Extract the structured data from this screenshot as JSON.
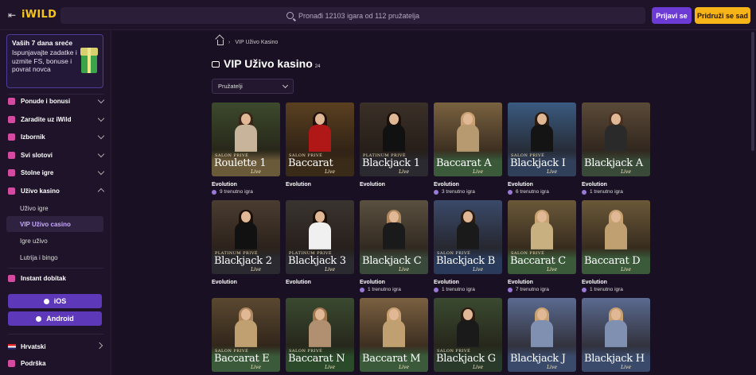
{
  "header": {
    "logo": "iWILD",
    "search_placeholder": "Pronađi 12103 igara od 112 pružatelja",
    "login_label": "Prijavi se",
    "join_label": "Pridruži se sad"
  },
  "sidebar": {
    "promo": {
      "title": "Vaših 7 dana sreće",
      "text": "Ispunjavajte zadatke i uzmite FS, bonuse i povrat novca"
    },
    "items": [
      {
        "label": "Ponude i bonusi",
        "icon": "gift-icon"
      },
      {
        "label": "Zaradite uz iWild",
        "icon": "coins-icon"
      },
      {
        "label": "Izbornik",
        "icon": "menu-icon"
      },
      {
        "label": "Svi slotovi",
        "icon": "slot-icon"
      },
      {
        "label": "Stolne igre",
        "icon": "table-icon"
      },
      {
        "label": "Uživo kasino",
        "icon": "live-icon"
      }
    ],
    "subitems": [
      {
        "label": "Uživo igre"
      },
      {
        "label": "VIP Uživo casino"
      },
      {
        "label": "Igre uživo"
      },
      {
        "label": "Lutrija i bingo"
      }
    ],
    "instant": "Instant dobitak",
    "ios_label": "iOS",
    "android_label": "Android",
    "language": "Hrvatski",
    "support": "Podrška"
  },
  "breadcrumb": {
    "current": "VIP Uživo Kasino"
  },
  "page": {
    "title": "VIP Uživo kasino",
    "count": "24",
    "filter_label": "Pružatelji"
  },
  "games": [
    {
      "sub": "SALON PRIVÉ",
      "name": "Roulette 1",
      "provider": "Evolution",
      "players": "9 trenutno igra",
      "bg": "#3c4a2c",
      "band": "#6b5a3a",
      "hair": "#3a2418",
      "dress": "#c8b49a"
    },
    {
      "sub": "SALON PRIVÉ",
      "name": "Baccarat",
      "provider": "Evolution",
      "players": "",
      "bg": "#5a4020",
      "band": "#3a2a18",
      "hair": "#201010",
      "dress": "#b01818"
    },
    {
      "sub": "PLATINUM PRIVÉ",
      "name": "Blackjack 1",
      "provider": "Evolution",
      "players": "",
      "bg": "#3a3028",
      "band": "#2a2a30",
      "hair": "#1a1008",
      "dress": "#111"
    },
    {
      "sub": "",
      "name": "Baccarat A",
      "provider": "Evolution",
      "players": "3 trenutno igra",
      "bg": "#7a6240",
      "band": "#3a5a3a",
      "hair": "#c9a070",
      "dress": "#b89a70"
    },
    {
      "sub": "SALON PRIVÉ",
      "name": "Blackjack I",
      "provider": "Evolution",
      "players": "6 trenutno igra",
      "bg": "#3a5a80",
      "band": "#30405a",
      "hair": "#2a1c10",
      "dress": "#141414"
    },
    {
      "sub": "",
      "name": "Blackjack A",
      "provider": "Evolution",
      "players": "1 trenutno igra",
      "bg": "#5a4a38",
      "band": "#3a4a38",
      "hair": "#4a3020",
      "dress": "#2a2a2a"
    },
    {
      "sub": "PLATINUM PRIVÉ",
      "name": "Blackjack 2",
      "provider": "Evolution",
      "players": "",
      "bg": "#4a3c30",
      "band": "#2a2a30",
      "hair": "#1a1008",
      "dress": "#111"
    },
    {
      "sub": "PLATINUM PRIVÉ",
      "name": "Blackjack 3",
      "provider": "Evolution",
      "players": "",
      "bg": "#3a3430",
      "band": "#2a2a30",
      "hair": "#1a1008",
      "dress": "#f0f0f0"
    },
    {
      "sub": "",
      "name": "Blackjack C",
      "provider": "Evolution",
      "players": "1 trenutno igra",
      "bg": "#5a5040",
      "band": "#3a4a3a",
      "hair": "#b08860",
      "dress": "#1a1a1a"
    },
    {
      "sub": "SALON PRIVÉ",
      "name": "Blackjack B",
      "provider": "Evolution",
      "players": "1 trenutno igra",
      "bg": "#3a4a6a",
      "band": "#2a3a5a",
      "hair": "#2a1c10",
      "dress": "#1a1a1a"
    },
    {
      "sub": "SALON PRIVÉ",
      "name": "Baccarat C",
      "provider": "Evolution",
      "players": "7 trenutno igra",
      "bg": "#6a5838",
      "band": "#3a5a3a",
      "hair": "#c9a070",
      "dress": "#c9b080"
    },
    {
      "sub": "",
      "name": "Baccarat D",
      "provider": "Evolution",
      "players": "1 trenutno igra",
      "bg": "#6a5838",
      "band": "#3a5a3a",
      "hair": "#c9a070",
      "dress": "#c0a070"
    },
    {
      "sub": "SALON PRIVÉ",
      "name": "Baccarat E",
      "provider": "",
      "players": "",
      "bg": "#5a4830",
      "band": "#3a5a3a",
      "hair": "#b08860",
      "dress": "#c0a070"
    },
    {
      "sub": "SALON PRIVÉ",
      "name": "Baccarat N",
      "provider": "",
      "players": "",
      "bg": "#3a4a30",
      "band": "#2a4a2a",
      "hair": "#a07850",
      "dress": "#b09070"
    },
    {
      "sub": "",
      "name": "Baccarat M",
      "provider": "",
      "players": "",
      "bg": "#7a6040",
      "band": "#3a5a3a",
      "hair": "#c9a070",
      "dress": "#c0a070"
    },
    {
      "sub": "SALON PRIVÉ",
      "name": "Blackjack G",
      "provider": "",
      "players": "",
      "bg": "#3a4a30",
      "band": "#2a3a2a",
      "hair": "#2a1c10",
      "dress": "#1a1a1a"
    },
    {
      "sub": "",
      "name": "Blackjack J",
      "provider": "",
      "players": "",
      "bg": "#5a6a90",
      "band": "#3a4a6a",
      "hair": "#c9a070",
      "dress": "#8090b0"
    },
    {
      "sub": "",
      "name": "Blackjack H",
      "provider": "",
      "players": "",
      "bg": "#5a6a90",
      "band": "#3a4a6a",
      "hair": "#c9a070",
      "dress": "#8090b0"
    }
  ]
}
